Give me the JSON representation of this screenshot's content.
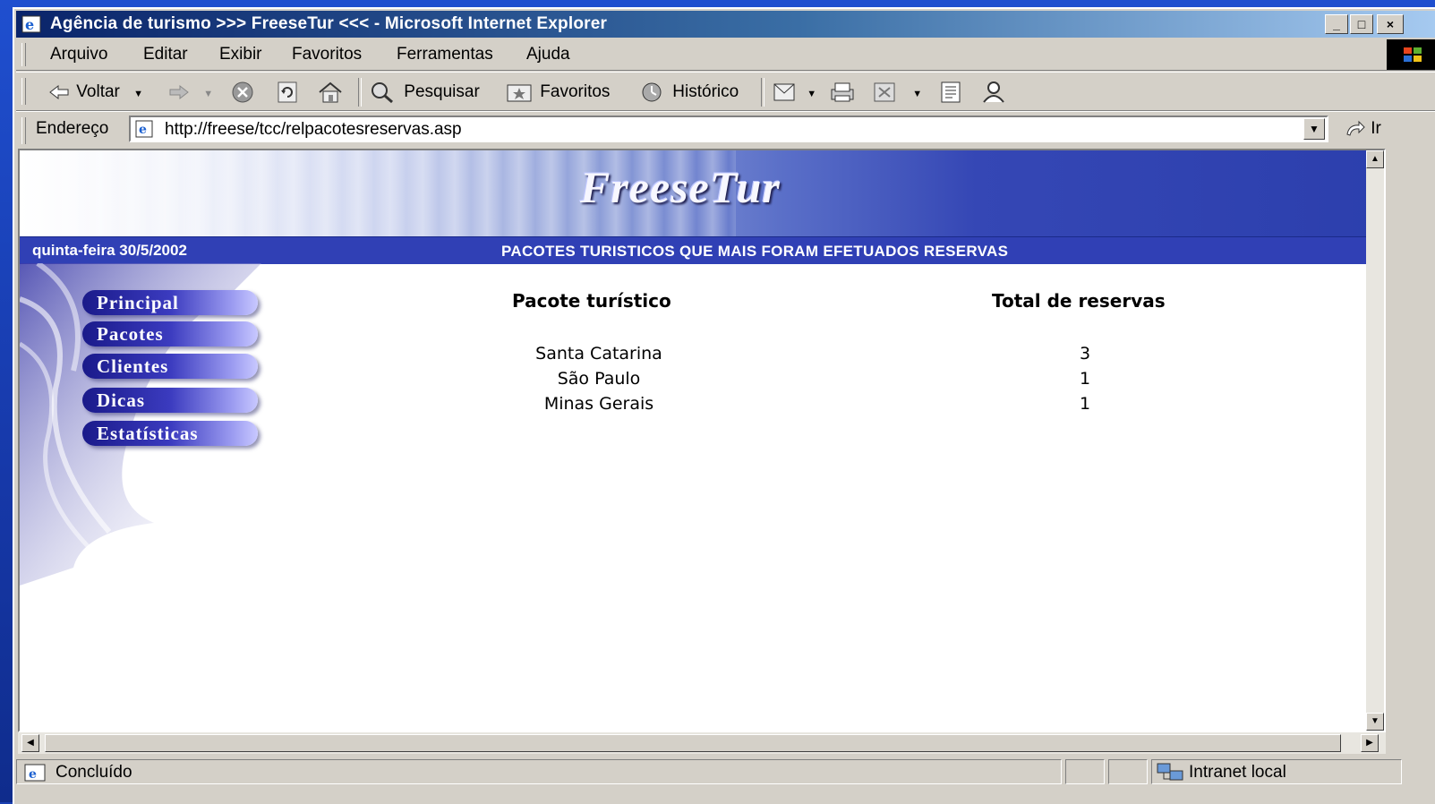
{
  "window": {
    "title": "Agência de turismo >>> FreeseTur <<< - Microsoft Internet Explorer",
    "minimize_label": "_",
    "maximize_label": "□",
    "close_label": "×"
  },
  "menubar": {
    "items": [
      {
        "label": "Arquivo"
      },
      {
        "label": "Editar"
      },
      {
        "label": "Exibir"
      },
      {
        "label": "Favoritos"
      },
      {
        "label": "Ferramentas"
      },
      {
        "label": "Ajuda"
      }
    ]
  },
  "toolbar": {
    "back_label": "Voltar",
    "search_label": "Pesquisar",
    "favorites_label": "Favoritos",
    "history_label": "Histórico"
  },
  "address": {
    "label": "Endereço",
    "url": "http://freese/tcc/relpacotesreservas.asp",
    "go_label": "Ir"
  },
  "site": {
    "logo": "FreeseTur",
    "date": "quinta-feira  30/5/2002",
    "report_title": "PACOTES TURISTICOS QUE MAIS FORAM EFETUADOS RESERVAS",
    "nav": [
      {
        "label": "Principal"
      },
      {
        "label": "Pacotes"
      },
      {
        "label": "Clientes"
      },
      {
        "label": "Dicas"
      },
      {
        "label": "Estatísticas"
      }
    ]
  },
  "report": {
    "headers": [
      "Pacote turístico",
      "Total de reservas"
    ],
    "rows": [
      {
        "package": "Santa Catarina",
        "total": "3"
      },
      {
        "package": "São Paulo",
        "total": "1"
      },
      {
        "package": "Minas Gerais",
        "total": "1"
      }
    ]
  },
  "status": {
    "text": "Concluído",
    "zone": "Intranet local"
  },
  "colors": {
    "title_bar": "#0a246a",
    "site_bar": "#3040b5",
    "chrome": "#d4d0c8"
  }
}
